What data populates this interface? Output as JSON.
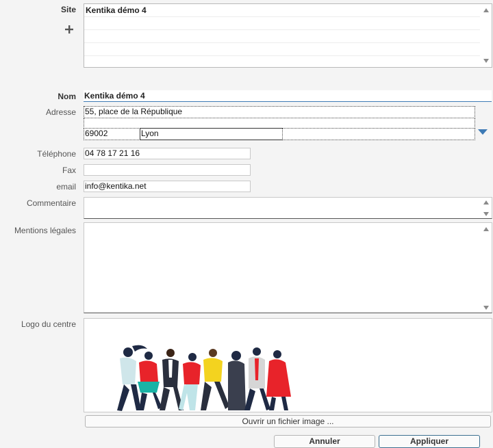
{
  "form": {
    "site_label": "Site",
    "site_items": [
      "Kentika démo 4",
      "",
      "",
      ""
    ],
    "nom_label": "Nom",
    "nom_value": "Kentika démo 4",
    "adresse_label": "Adresse",
    "adresse_line1": "55, place de la République",
    "adresse_line2": "",
    "postal_code": "69002",
    "city": "Lyon",
    "country": "",
    "telephone_label": "Téléphone",
    "telephone_value": "04 78 17 21 16",
    "fax_label": "Fax",
    "fax_value": "",
    "email_label": "email",
    "email_value": "info@kentika.net",
    "commentaire_label": "Commentaire",
    "commentaire_value": "",
    "mentions_label": "Mentions légales",
    "mentions_value": "",
    "logo_label": "Logo du centre",
    "open_image_button": "Ouvrir un fichier image ..."
  },
  "actions": {
    "cancel": "Annuler",
    "apply": "Appliquer"
  },
  "colors": {
    "accent": "#3d7ab5",
    "apply_border": "#3b6f8f"
  },
  "icons": {
    "add": "plus-icon",
    "dropdown": "triangle-down-icon"
  }
}
